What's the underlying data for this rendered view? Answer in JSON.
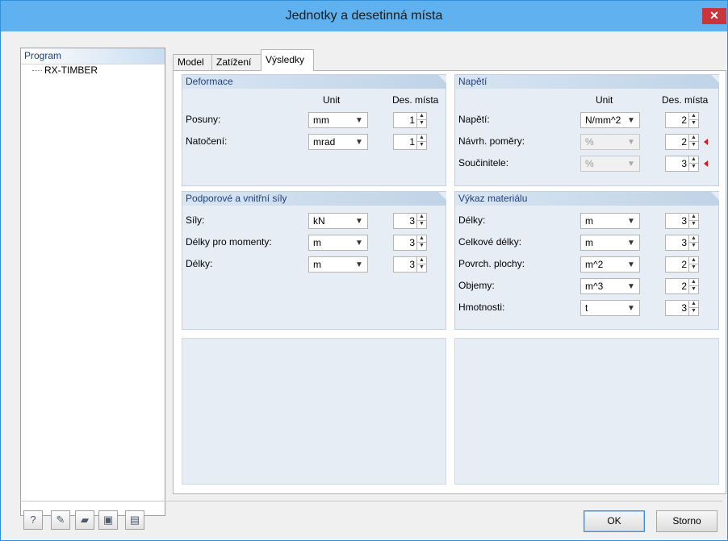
{
  "window": {
    "title": "Jednotky a desetinná místa",
    "close_glyph": "✕"
  },
  "left_panel": {
    "header": "Program",
    "items": [
      "RX-TIMBER"
    ]
  },
  "tabs": [
    "Model",
    "Zatížení",
    "Výsledky"
  ],
  "active_tab": "Výsledky",
  "columns": {
    "unit": "Unit",
    "decimals": "Des. místa"
  },
  "groups": {
    "deformace": {
      "title": "Deformace",
      "rows": [
        {
          "label": "Posuny:",
          "unit": "mm",
          "decimals": "1"
        },
        {
          "label": "Natočení:",
          "unit": "mrad",
          "decimals": "1"
        }
      ]
    },
    "napeti": {
      "title": "Napětí",
      "rows": [
        {
          "label": "Napětí:",
          "unit": "N/mm^2",
          "decimals": "2",
          "disabled": false
        },
        {
          "label": "Návrh. poměry:",
          "unit": "%",
          "decimals": "2",
          "disabled": true
        },
        {
          "label": "Součinitele:",
          "unit": "%",
          "decimals": "3",
          "disabled": true
        }
      ]
    },
    "sily": {
      "title": "Podporové a vnitřní síly",
      "rows": [
        {
          "label": "Síly:",
          "unit": "kN",
          "decimals": "3"
        },
        {
          "label": "Délky pro momenty:",
          "unit": "m",
          "decimals": "3"
        },
        {
          "label": "Délky:",
          "unit": "m",
          "decimals": "3"
        }
      ]
    },
    "vykaz": {
      "title": "Výkaz materiálu",
      "rows": [
        {
          "label": "Délky:",
          "unit": "m",
          "decimals": "3"
        },
        {
          "label": "Celkové délky:",
          "unit": "m",
          "decimals": "3"
        },
        {
          "label": "Povrch. plochy:",
          "unit": "m^2",
          "decimals": "2"
        },
        {
          "label": "Objemy:",
          "unit": "m^3",
          "decimals": "2"
        },
        {
          "label": "Hmotnosti:",
          "unit": "t",
          "decimals": "3"
        }
      ]
    }
  },
  "toolbar": {
    "icons": [
      "help-icon",
      "edit-icon",
      "open-folder-icon",
      "save-icon",
      "copy-settings-icon"
    ],
    "glyphs": [
      "?",
      "✎",
      "▰",
      "▣",
      "▤"
    ]
  },
  "buttons": {
    "ok": "OK",
    "cancel": "Storno"
  },
  "colors": {
    "titlebar": "#5fb1f0",
    "close": "#c9353b",
    "group_bg": "#e6edf5",
    "group_header_text": "#1f3f7a",
    "marker": "#e01a1a"
  }
}
